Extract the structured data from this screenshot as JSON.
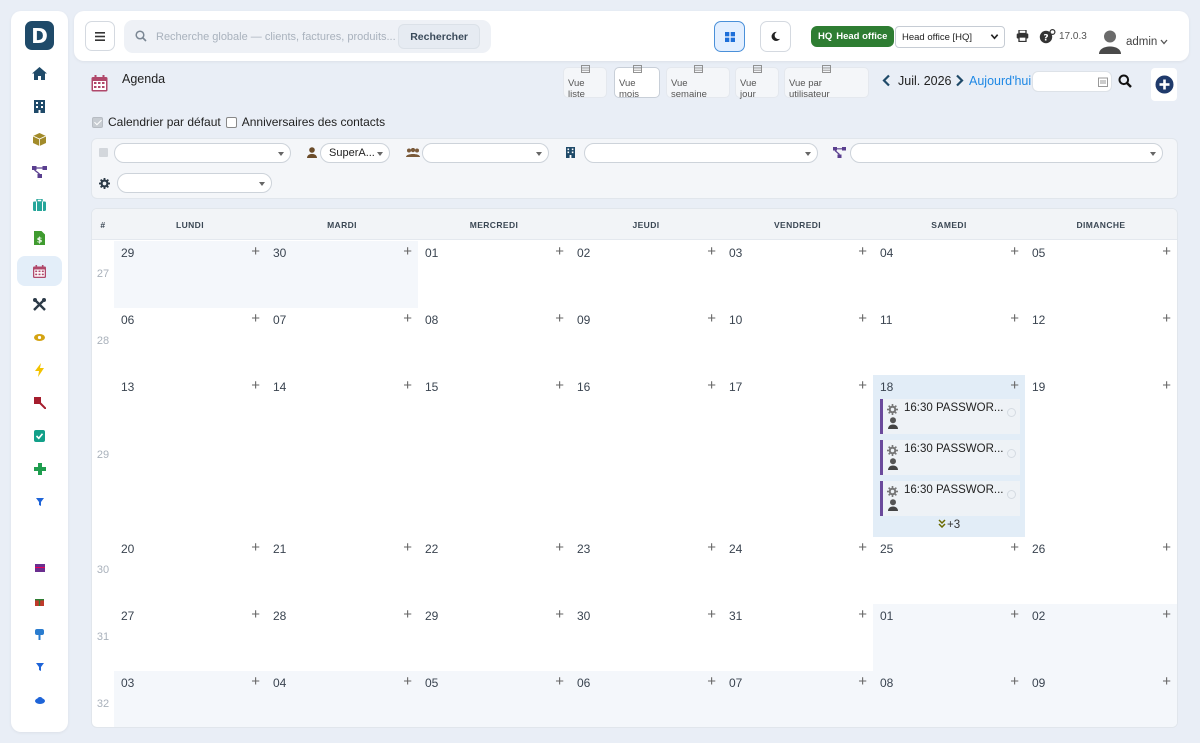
{
  "sidebar": {
    "logo": "D",
    "items": [
      {
        "icon": "home-icon",
        "color": "#1f4a69",
        "active": false
      },
      {
        "icon": "building-icon",
        "color": "#1f4a69",
        "active": false
      },
      {
        "icon": "product-box-icon",
        "color": "#a28b2a",
        "active": false
      },
      {
        "icon": "workflow-icon",
        "color": "#5a3f8f",
        "active": false
      },
      {
        "icon": "briefcase-icon",
        "color": "#26a69a",
        "active": false
      },
      {
        "icon": "invoice-dollar-icon",
        "color": "#3f9b2f",
        "active": false
      },
      {
        "icon": "calendar-icon",
        "color": "#b0486b",
        "active": true
      },
      {
        "icon": "tools-icon",
        "color": "#2d3b48",
        "active": false
      },
      {
        "icon": "eye-icon",
        "color": "#d4a312",
        "active": false
      },
      {
        "icon": "lightning-icon",
        "color": "#f2c200",
        "active": false
      },
      {
        "icon": "pencil-ruler-icon",
        "color": "#a51d2d",
        "active": false
      },
      {
        "icon": "check-shield-icon",
        "color": "#12a089",
        "active": false
      },
      {
        "icon": "plus-cross-icon",
        "color": "#1f9d4e",
        "active": false
      },
      {
        "icon": "filter-icon",
        "color": "#1e64d8",
        "active": false
      },
      {
        "icon": "grid-module-icon",
        "color": "#6a2e8f",
        "active": false
      },
      {
        "icon": "gift-icon",
        "color": "#c0392b",
        "active": false
      },
      {
        "icon": "pin-icon",
        "color": "#2a7ccf",
        "active": false
      },
      {
        "icon": "filter-small-icon",
        "color": "#1e64d8",
        "active": false
      },
      {
        "icon": "cloud-icon",
        "color": "#1e64d8",
        "active": false
      }
    ]
  },
  "topbar": {
    "search_placeholder": "Recherche globale — clients, factures, produits...",
    "search_button": "Rechercher",
    "hq_code": "HQ",
    "hq_label": "Head office",
    "entity_value": "Head office [HQ]",
    "version": "17.0.3",
    "user_name": "admin"
  },
  "agenda": {
    "title": "Agenda",
    "views": [
      {
        "label": "Vue liste",
        "active": false
      },
      {
        "label": "Vue mois",
        "active": true
      },
      {
        "label": "Vue semaine",
        "active": false
      },
      {
        "label": "Vue jour",
        "active": false
      },
      {
        "label": "Vue par utilisateur",
        "active": false
      }
    ],
    "month_label": "Juil. 2026",
    "today_label": "Aujourd'hui",
    "checkboxes": [
      {
        "label": "Calendrier par défaut",
        "checked": true
      },
      {
        "label": "Anniversaires des contacts",
        "checked": false
      }
    ],
    "filters": {
      "user_value": "SuperA..."
    }
  },
  "calendar": {
    "week_header": "#",
    "day_headers": [
      "LUNDI",
      "MARDI",
      "MERCREDI",
      "JEUDI",
      "VENDREDI",
      "SAMEDI",
      "DIMANCHE"
    ],
    "add_symbol": "+",
    "weeks": [
      {
        "num": "27",
        "days": [
          {
            "d": "29",
            "other": true
          },
          {
            "d": "30",
            "other": true
          },
          {
            "d": "01"
          },
          {
            "d": "02"
          },
          {
            "d": "03"
          },
          {
            "d": "04"
          },
          {
            "d": "05"
          }
        ]
      },
      {
        "num": "28",
        "days": [
          {
            "d": "06"
          },
          {
            "d": "07"
          },
          {
            "d": "08"
          },
          {
            "d": "09"
          },
          {
            "d": "10"
          },
          {
            "d": "11"
          },
          {
            "d": "12"
          }
        ]
      },
      {
        "num": "29",
        "days": [
          {
            "d": "13"
          },
          {
            "d": "14"
          },
          {
            "d": "15"
          },
          {
            "d": "16"
          },
          {
            "d": "17"
          },
          {
            "d": "18",
            "today": true
          },
          {
            "d": "19"
          }
        ]
      },
      {
        "num": "30",
        "days": [
          {
            "d": "20"
          },
          {
            "d": "21"
          },
          {
            "d": "22"
          },
          {
            "d": "23"
          },
          {
            "d": "24"
          },
          {
            "d": "25"
          },
          {
            "d": "26"
          }
        ]
      },
      {
        "num": "31",
        "days": [
          {
            "d": "27"
          },
          {
            "d": "28"
          },
          {
            "d": "29"
          },
          {
            "d": "30"
          },
          {
            "d": "31"
          },
          {
            "d": "01",
            "other": true
          },
          {
            "d": "02",
            "other": true
          }
        ]
      },
      {
        "num": "32",
        "days": [
          {
            "d": "03",
            "other": true
          },
          {
            "d": "04",
            "other": true
          },
          {
            "d": "05",
            "other": true
          },
          {
            "d": "06",
            "other": true
          },
          {
            "d": "07",
            "other": true
          },
          {
            "d": "08",
            "other": true
          },
          {
            "d": "09",
            "other": true
          }
        ]
      }
    ],
    "events": [
      {
        "text": "16:30 PASSWOR..."
      },
      {
        "text": "16:30 PASSWOR..."
      },
      {
        "text": "16:30 PASSWOR..."
      }
    ],
    "more_label": "+3",
    "colors": {
      "today_bg": "#e2edf7",
      "other_bg": "#f4f7fb",
      "event_border": "#6b4a9c"
    }
  }
}
